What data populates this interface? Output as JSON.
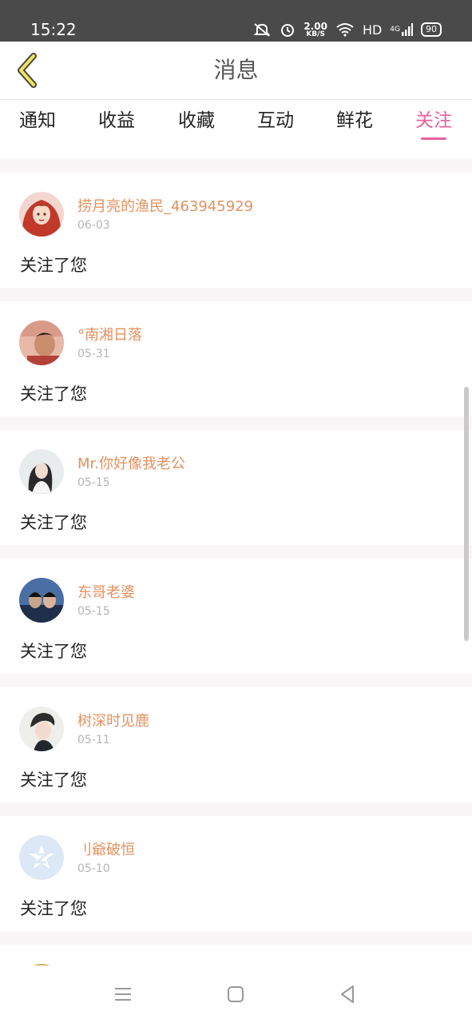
{
  "status_bar": {
    "time": "15:22",
    "net_speed_value": "2.00",
    "net_speed_unit": "KB/S",
    "hd_label": "HD",
    "signal_label": "4G",
    "battery": "90"
  },
  "header": {
    "title": "消息",
    "back_icon": "chevron-left-icon"
  },
  "tabs": [
    {
      "label": "通知",
      "active": false
    },
    {
      "label": "收益",
      "active": false
    },
    {
      "label": "收藏",
      "active": false
    },
    {
      "label": "互动",
      "active": false
    },
    {
      "label": "鲜花",
      "active": false
    },
    {
      "label": "关注",
      "active": true
    }
  ],
  "notifications": [
    {
      "username": "捞月亮的渔民_463945929",
      "date": "06-03",
      "message": "关注了您"
    },
    {
      "username": "°南湘日落",
      "date": "05-31",
      "message": "关注了您"
    },
    {
      "username": "Mr.你好像我老公",
      "date": "05-15",
      "message": "关注了您"
    },
    {
      "username": "东哥老婆",
      "date": "05-15",
      "message": "关注了您"
    },
    {
      "username": "树深时见鹿",
      "date": "05-11",
      "message": "关注了您"
    },
    {
      "username": " 刂爺破恒",
      "date": "05-10",
      "message": "关注了您"
    }
  ],
  "colors": {
    "accent": "#e8609e",
    "username": "#e3915f",
    "back_icon": "#f2e25c"
  },
  "nav_bar": [
    "menu-icon",
    "home-square-icon",
    "back-triangle-icon"
  ]
}
